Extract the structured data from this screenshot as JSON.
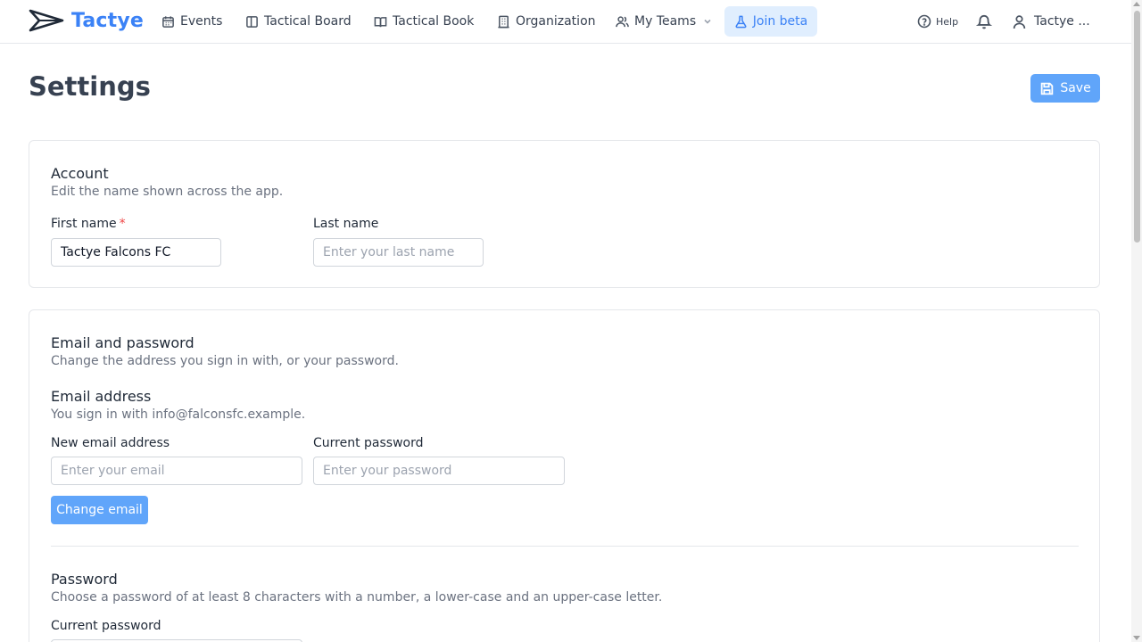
{
  "brand": {
    "name": "Tactye",
    "accent": "#3b82f6"
  },
  "nav": {
    "events": "Events",
    "tactical_board": "Tactical Board",
    "tactical_book": "Tactical Book",
    "organization": "Organization",
    "my_teams": "My Teams",
    "join_beta": "Join beta",
    "help": "Help",
    "user": "Tactye ..."
  },
  "page": {
    "title": "Settings",
    "save_label": "Save"
  },
  "account": {
    "title": "Account",
    "description": "Edit the name shown across the app.",
    "first_name_label": "First name",
    "required_mark": "*",
    "first_name_value": "Tactye Falcons FC",
    "last_name_label": "Last name",
    "last_name_placeholder": "Enter your last name"
  },
  "email_password": {
    "title": "Email and password",
    "description": "Change the address you sign in with, or your password.",
    "email_section_title": "Email address",
    "email_section_desc": "You sign in with info@falconsfc.example.",
    "new_email_label": "New email address",
    "new_email_placeholder": "Enter your email",
    "current_password_label": "Current password",
    "current_password_placeholder": "Enter your password",
    "change_email_label": "Change email",
    "password_section_title": "Password",
    "password_section_desc": "Choose a password of at least 8 characters with a number, a lower-case and an upper-case letter.",
    "password_current_label": "Current password"
  }
}
